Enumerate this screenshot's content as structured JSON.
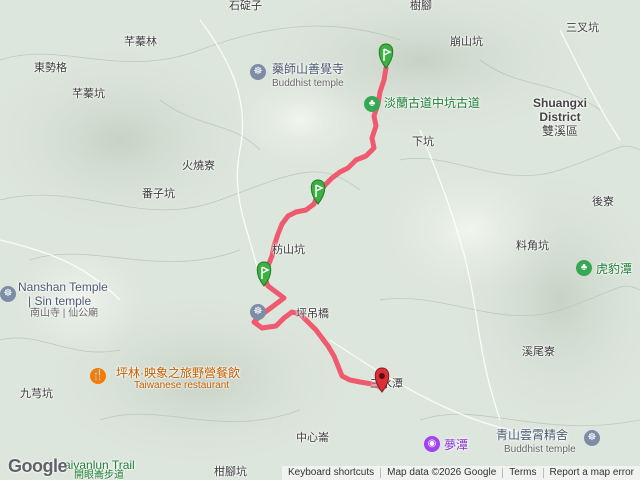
{
  "map": {
    "labels": [
      {
        "text": "石碇子",
        "name": "label-shidingzi"
      },
      {
        "text": "樹腳",
        "name": "label-shujiao"
      },
      {
        "text": "三叉坑",
        "name": "label-sanchakeng"
      },
      {
        "text": "芊蓁林",
        "name": "label-qianzhenlin"
      },
      {
        "text": "崩山坑",
        "name": "label-bengshankeng"
      },
      {
        "text": "東勢格",
        "name": "label-dongshige"
      },
      {
        "text": "芊蓁坑",
        "name": "label-qianzhenkeng"
      },
      {
        "text": "下坑",
        "name": "label-xiakeng"
      },
      {
        "text": "火燒寮",
        "name": "label-huoshaoliao"
      },
      {
        "text": "番子坑",
        "name": "label-fanzikeng"
      },
      {
        "text": "後寮",
        "name": "label-houliao"
      },
      {
        "text": "枋山坑",
        "name": "label-fangshankeng"
      },
      {
        "text": "料角坑",
        "name": "label-liaojiaokeng"
      },
      {
        "text": "坪吊橋",
        "name": "label-pingdiaoqiao"
      },
      {
        "text": "溪尾寮",
        "name": "label-xiweiliao"
      },
      {
        "text": "九芎坑",
        "name": "label-jiuqiongkeng"
      },
      {
        "text": "三水潭",
        "name": "label-sanshuitan"
      },
      {
        "text": "中心崙",
        "name": "label-zhongxinlun"
      },
      {
        "text": "柑腳坑",
        "name": "label-ganjiaokeng"
      }
    ],
    "district": {
      "en_line1": "Shuangxi",
      "en_line2": "District",
      "zh": "雙溪區"
    },
    "pois": {
      "temple_north": {
        "zh": "藥師山善覺寺",
        "en": "Buddhist temple"
      },
      "trail": {
        "zh": "淡蘭古道中坑古道"
      },
      "nanshan": {
        "en_line1": "Nanshan Temple",
        "en_line2": "| Sin temple",
        "zh": "南山寺 | 仙公廟"
      },
      "restaurant": {
        "zh": "坪林·映象之旅野營餐飲",
        "en": "Taiwanese restaurant"
      },
      "hubaotan": {
        "zh": "虎豹潭"
      },
      "mengtan": {
        "zh": "夢潭"
      },
      "qingshan": {
        "zh": "青山雲霄精舍",
        "en": "Buddhist temple"
      },
      "bottom_trail": {
        "en": "aivanlun Trail",
        "zh": "開眼崙步道"
      }
    },
    "google_logo": "Google",
    "attribution": {
      "shortcuts": "Keyboard shortcuts",
      "data": "Map data ©2026 Google",
      "terms": "Terms",
      "report": "Report a map error"
    },
    "colors": {
      "route": "#f05a6e",
      "start_marker": "#3cb043",
      "end_marker": "#d93038",
      "park": "#34a853",
      "restaurant": "#f57c00",
      "attraction": "#a142f4",
      "temple": "#7d8da6"
    }
  }
}
